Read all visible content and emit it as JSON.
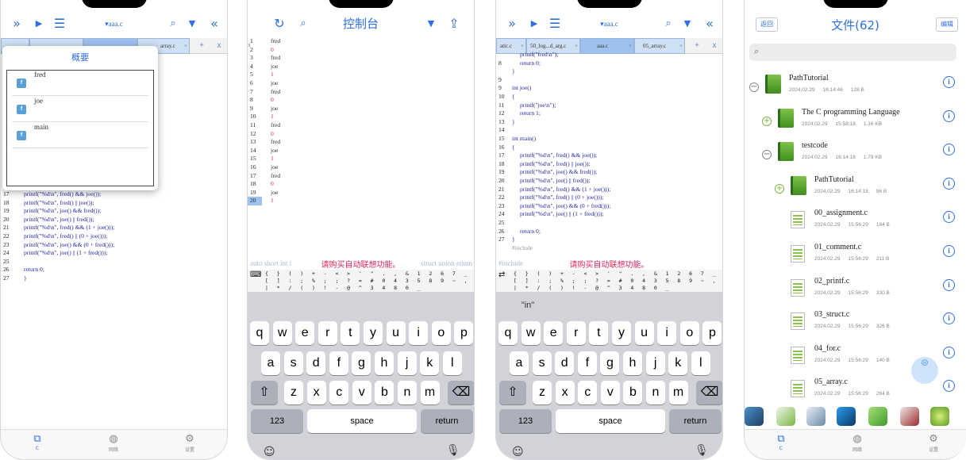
{
  "phone1": {
    "status_frag": "",
    "file_title": "▾aaa.c",
    "popup_title": "概要",
    "popup_items": [
      {
        "label": "fred"
      },
      {
        "label": "joe"
      },
      {
        "label": "main"
      }
    ],
    "tabs": [
      {
        "label": ""
      },
      {
        "label": ""
      },
      {
        "label": ""
      },
      {
        "label": "array.c"
      }
    ],
    "add_label": "+",
    "close_label": "x",
    "lines": [
      {
        "n": "17",
        "t": "printf(\"%d\\n\", fred() && joe());"
      },
      {
        "n": "18",
        "t": "printf(\"%d\\n\", fred() || joe());"
      },
      {
        "n": "19",
        "t": "printf(\"%d\\n\", joe() && fred());"
      },
      {
        "n": "20",
        "t": "printf(\"%d\\n\", joe() || fred());"
      },
      {
        "n": "21",
        "t": "printf(\"%d\\n\", fred() && (1 + joe()));"
      },
      {
        "n": "22",
        "t": "printf(\"%d\\n\", fred() || (0 + joe()));"
      },
      {
        "n": "23",
        "t": "printf(\"%d\\n\", joe() && (0 + fred()));"
      },
      {
        "n": "24",
        "t": "printf(\"%d\\n\", joe() || (1 + fred()));"
      },
      {
        "n": "25",
        "t": ""
      },
      {
        "n": "26",
        "t": "return 0;"
      },
      {
        "n": "27",
        "t": "}"
      }
    ],
    "nav": [
      {
        "label": "C"
      },
      {
        "label": "网络"
      },
      {
        "label": "设置"
      }
    ]
  },
  "phone2": {
    "title": "控制台",
    "side_x": "x",
    "lines": [
      {
        "n": "1",
        "t": "fred"
      },
      {
        "n": "2",
        "t": "0"
      },
      {
        "n": "3",
        "t": "fred"
      },
      {
        "n": "4",
        "t": "joe"
      },
      {
        "n": "5",
        "t": "1"
      },
      {
        "n": "6",
        "t": "joe"
      },
      {
        "n": "7",
        "t": "fred"
      },
      {
        "n": "8",
        "t": "0"
      },
      {
        "n": "9",
        "t": "joe"
      },
      {
        "n": "10",
        "t": "1"
      },
      {
        "n": "11",
        "t": "fred"
      },
      {
        "n": "12",
        "t": "0"
      },
      {
        "n": "13",
        "t": "fred"
      },
      {
        "n": "14",
        "t": "joe"
      },
      {
        "n": "15",
        "t": "1"
      },
      {
        "n": "16",
        "t": "joe"
      },
      {
        "n": "17",
        "t": "fred"
      },
      {
        "n": "18",
        "t": "0"
      },
      {
        "n": "19",
        "t": "joe"
      },
      {
        "n": "20",
        "t": "1"
      }
    ],
    "suggest_bg": "auto   short   int   l",
    "suggest_tail": "struct   union   enum",
    "suggest_msg": "请购买自动联想功能。",
    "sym_row1": "{  }  (  )  +  -  <  >  '  \"  .  ,  &  1  2  6  7  _  ,",
    "sym_row2": "[  ]  :  ;  %  ;  ;  ?  =  #  0  4  3  5  8  9  ~  ,",
    "sym_row3": "|  *  /  (  )  !  -  @  ^  3  4  8  0  _",
    "keys_row1": [
      "q",
      "w",
      "e",
      "r",
      "t",
      "y",
      "u",
      "i",
      "o",
      "p"
    ],
    "keys_row2": [
      "a",
      "s",
      "d",
      "f",
      "g",
      "h",
      "j",
      "k",
      "l"
    ],
    "keys_row3": [
      "z",
      "x",
      "c",
      "v",
      "b",
      "n",
      "m"
    ],
    "key_123": "123",
    "key_space": "space",
    "key_return": "return"
  },
  "phone3": {
    "file_title": "▾aaa.c",
    "tabs": [
      {
        "label": "atic.c"
      },
      {
        "label": "50_log...d_arg.c"
      },
      {
        "label": "aaa.c"
      },
      {
        "label": "05_array.c"
      }
    ],
    "add_label": "+",
    "close_label": "x",
    "lines": [
      {
        "n": "",
        "t": "printf(\"fred\\n\");"
      },
      {
        "n": "8",
        "t": "return 0;"
      },
      {
        "n": "",
        "t": "}"
      },
      {
        "n": "9",
        "t": ""
      },
      {
        "n": "9",
        "t": "int joe()"
      },
      {
        "n": "10",
        "t": "{"
      },
      {
        "n": "11",
        "t": "printf(\"joe\\n\");"
      },
      {
        "n": "12",
        "t": "return 1;"
      },
      {
        "n": "13",
        "t": "}"
      },
      {
        "n": "14",
        "t": ""
      },
      {
        "n": "15",
        "t": "int main()"
      },
      {
        "n": "16",
        "t": "{"
      },
      {
        "n": "17",
        "t": "printf(\"%d\\n\", fred() && joe());"
      },
      {
        "n": "18",
        "t": "printf(\"%d\\n\", fred() || joe());"
      },
      {
        "n": "19",
        "t": "printf(\"%d\\n\", joe() && fred());"
      },
      {
        "n": "20",
        "t": "printf(\"%d\\n\", joe() || fred());"
      },
      {
        "n": "21",
        "t": "printf(\"%d\\n\", fred() && (1 + joe()));"
      },
      {
        "n": "22",
        "t": "printf(\"%d\\n\", fred() || (0 + joe()));"
      },
      {
        "n": "23",
        "t": "printf(\"%d\\n\", joe() && (0 + fred()));"
      },
      {
        "n": "24",
        "t": "printf(\"%d\\n\", joe() || (1 + fred()));"
      },
      {
        "n": "25",
        "t": ""
      },
      {
        "n": "26",
        "t": "return 0;"
      },
      {
        "n": "27",
        "t": "}"
      },
      {
        "n": "",
        "t": "#include"
      }
    ],
    "suggest_bg": "#include",
    "suggest_msg": "请购买自动联想功能。",
    "prediction": "\"in\"",
    "key_123": "123",
    "key_space": "space",
    "key_return": "return"
  },
  "phone4": {
    "back_label": "返回",
    "title": "文件(62)",
    "edit_label": "编辑",
    "search_placeholder": "",
    "files": [
      {
        "name": "PathTutorial",
        "date": "2024.02.29",
        "time": "16:14:46",
        "size": "128 B",
        "kind": "folder",
        "level": 0,
        "toggle": "−"
      },
      {
        "name": "The C programming Language",
        "date": "2024.02.29",
        "time": "15:58:18",
        "size": "1.16 KB",
        "kind": "folder",
        "level": 1,
        "toggle": "+"
      },
      {
        "name": "testcode",
        "date": "2024.02.29",
        "time": "16:14:18",
        "size": "1.79 KB",
        "kind": "folder",
        "level": 1,
        "toggle": "−"
      },
      {
        "name": "PathTutorial",
        "date": "2024.02.29",
        "time": "16:14:18",
        "size": "96 B",
        "kind": "folder",
        "level": 2,
        "toggle": "+"
      },
      {
        "name": "00_assignment.c",
        "date": "2024.02.29",
        "time": "15:56:29",
        "size": "184 B",
        "kind": "file",
        "level": 2,
        "toggle": ""
      },
      {
        "name": "01_comment.c",
        "date": "2024.02.29",
        "time": "15:56:29",
        "size": "211 B",
        "kind": "file",
        "level": 2,
        "toggle": ""
      },
      {
        "name": "02_printf.c",
        "date": "2024.02.29",
        "time": "15:56:29",
        "size": "330 B",
        "kind": "file",
        "level": 2,
        "toggle": ""
      },
      {
        "name": "03_struct.c",
        "date": "2024.02.29",
        "time": "15:56:29",
        "size": "326 B",
        "kind": "file",
        "level": 2,
        "toggle": ""
      },
      {
        "name": "04_for.c",
        "date": "2024.02.29",
        "time": "15:56:29",
        "size": "140 B",
        "kind": "file",
        "level": 2,
        "toggle": ""
      },
      {
        "name": "05_array.c",
        "date": "2024.02.29",
        "time": "15:56:29",
        "size": "264 B",
        "kind": "file",
        "level": 2,
        "toggle": ""
      }
    ],
    "info_glyph": "i",
    "nav": [
      {
        "label": "C"
      },
      {
        "label": "网络"
      },
      {
        "label": "设置"
      }
    ],
    "colors": {
      "accent": "#2f6fe0",
      "folder": "#5aa332"
    }
  }
}
